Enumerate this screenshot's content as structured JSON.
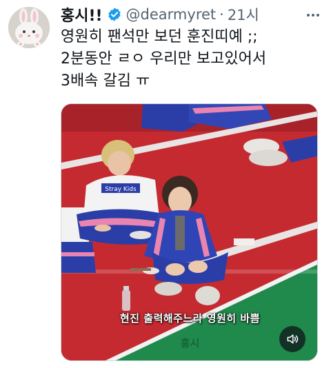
{
  "user": {
    "display_name": "홍시!!",
    "handle": "@dearmyret",
    "separator": "·",
    "time": "21시",
    "avatar_icon": "bunny-avatar"
  },
  "tweet": {
    "lines": [
      "영원히 팬석만 보던 훈진띠예 ;;",
      "2분동안 ㄹㅇ 우리만 보고있어서",
      "3배속 갈김 ㅠ"
    ]
  },
  "media": {
    "subtitle": "현진 출력해주느라 영원히 바쁨",
    "watermark": "홍시",
    "shirt_text": "Stray Kids",
    "volume_icon": "volume-icon"
  },
  "colors": {
    "verified": "#1d9bf0",
    "secondary_text": "#536471",
    "floor_red": "#c62a31",
    "floor_green": "#1f8a4c",
    "track_blue": "#2b3ea8",
    "track_pink": "#e985b0"
  }
}
